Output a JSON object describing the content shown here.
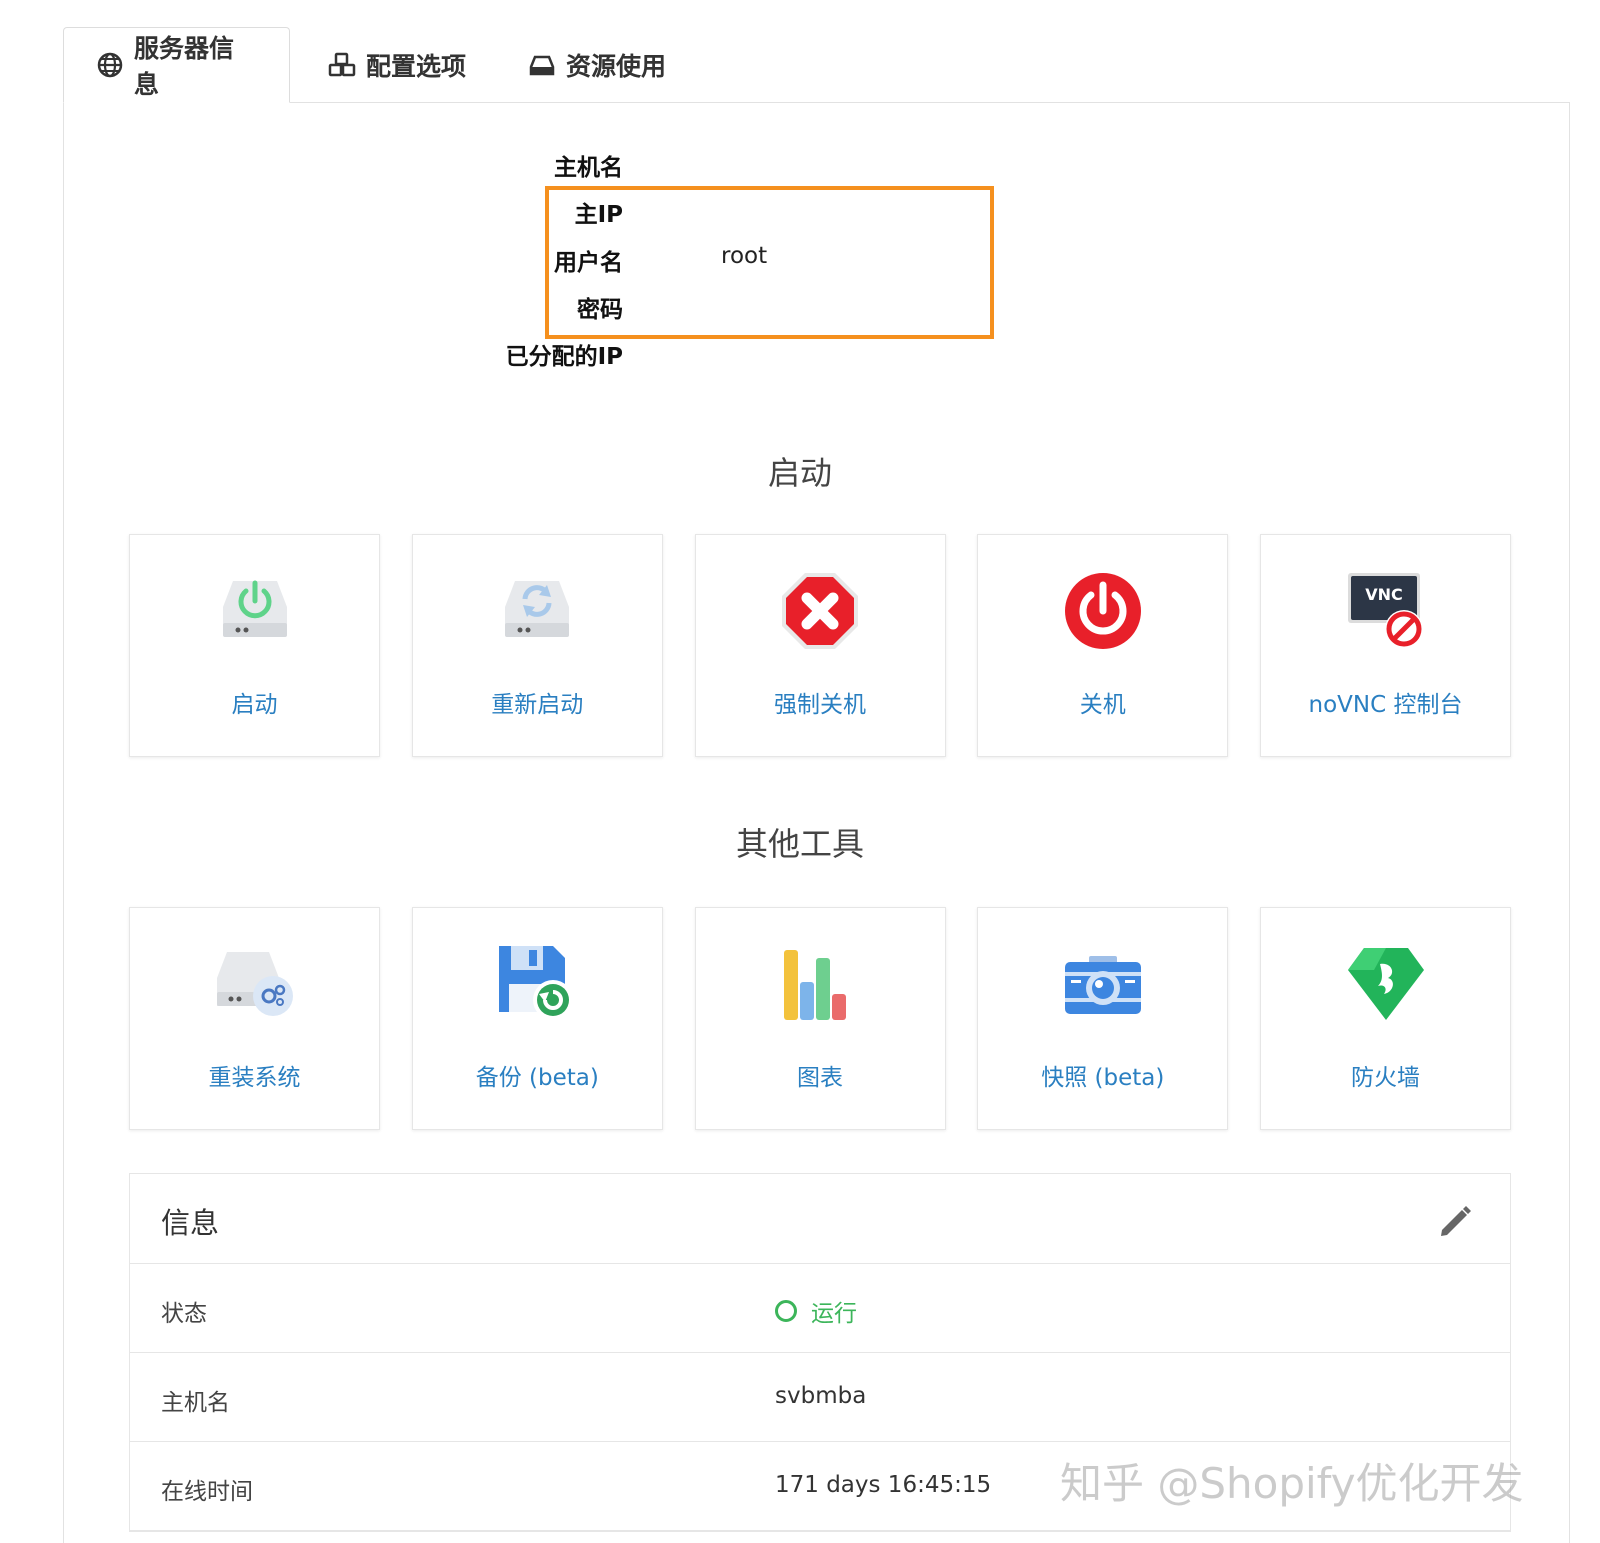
{
  "tabs": [
    {
      "label": "服务器信息",
      "icon": "globe-icon",
      "active": true
    },
    {
      "label": "配置选项",
      "icon": "cubes-icon",
      "active": false
    },
    {
      "label": "资源使用",
      "icon": "hdd-icon",
      "active": false
    }
  ],
  "server_info": {
    "hostname_label": "主机名",
    "main_ip_label": "主IP",
    "username_label": "用户名",
    "username_value": "root",
    "password_label": "密码",
    "assigned_ip_label": "已分配的IP",
    "highlight_color": "#f5901e"
  },
  "power_section": {
    "title": "启动",
    "cards": [
      {
        "label": "启动",
        "icon": "server-power-icon"
      },
      {
        "label": "重新启动",
        "icon": "server-restart-icon"
      },
      {
        "label": "强制关机",
        "icon": "force-stop-icon"
      },
      {
        "label": "关机",
        "icon": "power-off-icon"
      },
      {
        "label": "noVNC 控制台",
        "icon": "vnc-console-icon"
      }
    ]
  },
  "tools_section": {
    "title": "其他工具",
    "cards": [
      {
        "label": "重装系统",
        "icon": "reinstall-icon"
      },
      {
        "label": "备份 (beta)",
        "icon": "backup-icon"
      },
      {
        "label": "图表",
        "icon": "charts-icon"
      },
      {
        "label": "快照 (beta)",
        "icon": "snapshot-icon"
      },
      {
        "label": "防火墙",
        "icon": "firewall-icon"
      }
    ]
  },
  "info_panel": {
    "title": "信息",
    "rows": [
      {
        "label": "状态",
        "value": "运行"
      },
      {
        "label": "主机名",
        "value": "svbmba"
      },
      {
        "label": "在线时间",
        "value": "171 days 16:45:15"
      }
    ],
    "status_color": "#3cb55a"
  },
  "watermark": "知乎 @Shopify优化开发",
  "colors": {
    "link": "#2a7fc1",
    "accent_orange": "#f5901e",
    "status_green": "#3cb55a"
  }
}
